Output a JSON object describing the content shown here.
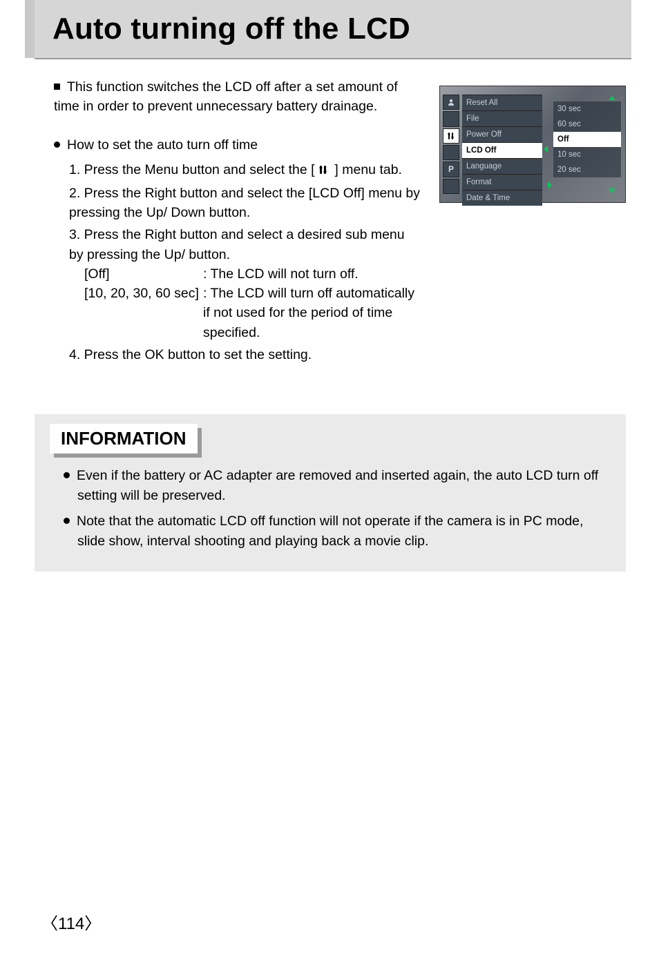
{
  "title": "Auto turning off the LCD",
  "lead": "This function switches the LCD off after a set amount of time in order to prevent unnecessary battery drainage.",
  "howto_heading": "How to set the auto turn off time",
  "steps": {
    "s1a": "1. Press the Menu button and select the [",
    "s1b": "] menu tab.",
    "s2": "2. Press the Right button and select the [LCD Off] menu by pressing the Up/ Down button.",
    "s3": "3. Press the Right button and select a desired sub menu by pressing the Up/ button.",
    "opt_off_key": "[Off]",
    "opt_off_val": ": The LCD will not turn off.",
    "opt_sec_key": "[10, 20, 30, 60 sec]",
    "opt_sec_val1": ": The LCD will turn off automatically",
    "opt_sec_val2": "if not used for the period of time",
    "opt_sec_val3": "specified.",
    "s4": "4. Press the OK button to set the setting."
  },
  "info_title": "INFORMATION",
  "info_items": [
    "Even if the battery or AC adapter are removed and inserted again, the auto LCD turn off setting will be preserved.",
    "Note that the automatic LCD off function will not operate if the camera is in PC mode, slide show, interval shooting and playing back a movie clip."
  ],
  "lcd": {
    "tabs": [
      "",
      "",
      "",
      "",
      "P",
      ""
    ],
    "active_tab_index": 2,
    "menu": [
      "Reset All",
      "File",
      "Power Off",
      "LCD Off",
      "Language",
      "Format",
      "Date & Time"
    ],
    "menu_selected_index": 3,
    "options": [
      "30 sec",
      "60 sec",
      "Off",
      "10 sec",
      "20 sec"
    ],
    "option_selected_index": 2
  },
  "page_number": "114"
}
